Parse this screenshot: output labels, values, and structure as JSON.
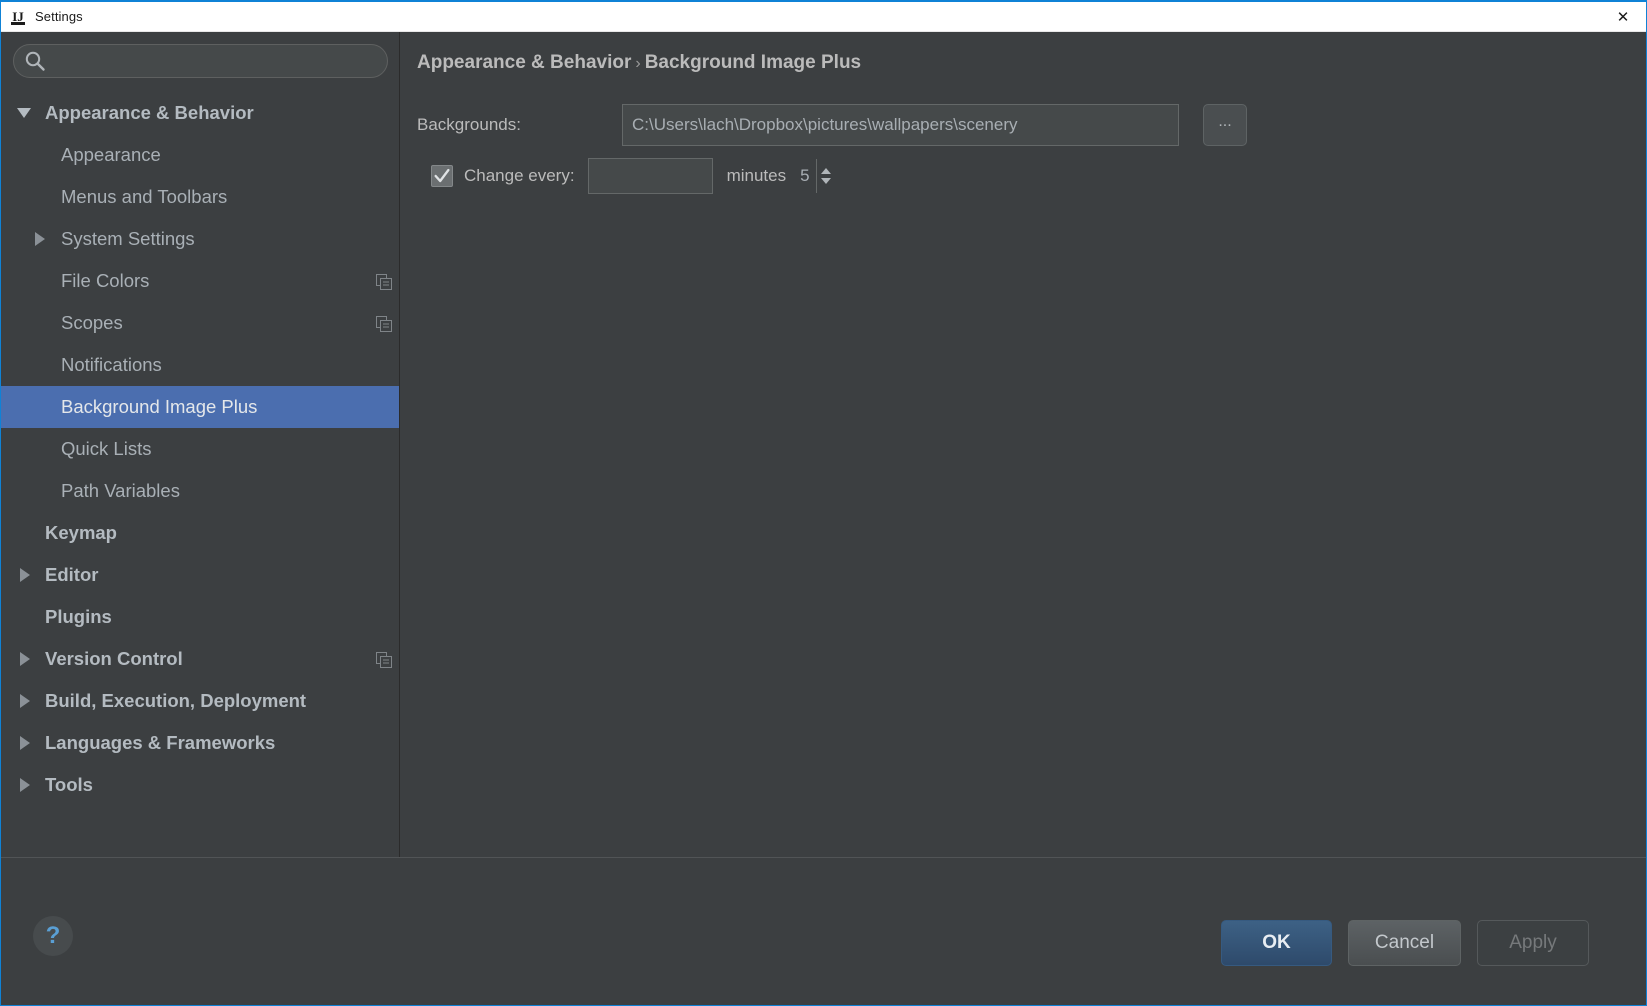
{
  "window": {
    "title": "Settings",
    "icon": "intellij-idea-icon",
    "close_label": "✕"
  },
  "search": {
    "value": "",
    "placeholder": "",
    "icon": "search-icon"
  },
  "sidebar": {
    "items": [
      {
        "label": "Appearance & Behavior",
        "level": 0,
        "arrow": "down",
        "bold": true,
        "selected": false,
        "copy_icon": false
      },
      {
        "label": "Appearance",
        "level": 1,
        "arrow": "none",
        "bold": false,
        "selected": false,
        "copy_icon": false
      },
      {
        "label": "Menus and Toolbars",
        "level": 1,
        "arrow": "none",
        "bold": false,
        "selected": false,
        "copy_icon": false
      },
      {
        "label": "System Settings",
        "level": 1,
        "arrow": "right",
        "bold": false,
        "selected": false,
        "copy_icon": false
      },
      {
        "label": "File Colors",
        "level": 1,
        "arrow": "none",
        "bold": false,
        "selected": false,
        "copy_icon": true
      },
      {
        "label": "Scopes",
        "level": 1,
        "arrow": "none",
        "bold": false,
        "selected": false,
        "copy_icon": true
      },
      {
        "label": "Notifications",
        "level": 1,
        "arrow": "none",
        "bold": false,
        "selected": false,
        "copy_icon": false
      },
      {
        "label": "Background Image Plus",
        "level": 1,
        "arrow": "none",
        "bold": false,
        "selected": true,
        "copy_icon": false
      },
      {
        "label": "Quick Lists",
        "level": 1,
        "arrow": "none",
        "bold": false,
        "selected": false,
        "copy_icon": false
      },
      {
        "label": "Path Variables",
        "level": 1,
        "arrow": "none",
        "bold": false,
        "selected": false,
        "copy_icon": false
      },
      {
        "label": "Keymap",
        "level": 0,
        "arrow": "none",
        "bold": true,
        "selected": false,
        "copy_icon": false
      },
      {
        "label": "Editor",
        "level": 0,
        "arrow": "right",
        "bold": true,
        "selected": false,
        "copy_icon": false
      },
      {
        "label": "Plugins",
        "level": 0,
        "arrow": "none",
        "bold": true,
        "selected": false,
        "copy_icon": false
      },
      {
        "label": "Version Control",
        "level": 0,
        "arrow": "right",
        "bold": true,
        "selected": false,
        "copy_icon": true
      },
      {
        "label": "Build, Execution, Deployment",
        "level": 0,
        "arrow": "right",
        "bold": true,
        "selected": false,
        "copy_icon": false
      },
      {
        "label": "Languages & Frameworks",
        "level": 0,
        "arrow": "right",
        "bold": true,
        "selected": false,
        "copy_icon": false
      },
      {
        "label": "Tools",
        "level": 0,
        "arrow": "right",
        "bold": true,
        "selected": false,
        "copy_icon": false
      }
    ]
  },
  "content": {
    "breadcrumb_parent": "Appearance & Behavior",
    "breadcrumb_separator": "›",
    "breadcrumb_current": "Background Image Plus",
    "backgrounds_label": "Backgrounds:",
    "backgrounds_value": "C:\\Users\\lach\\Dropbox\\pictures\\wallpapers\\scenery",
    "backgrounds_placeholder": "",
    "browse_label": "...",
    "change_every_label": "Change every:",
    "change_every_checked": true,
    "interval_value": "5",
    "interval_unit": "minutes"
  },
  "footer": {
    "help_label": "?",
    "ok_label": "OK",
    "cancel_label": "Cancel",
    "apply_label": "Apply",
    "apply_disabled": true
  },
  "colors": {
    "window_border": "#0f82d6",
    "panel_bg": "#3c3f41",
    "selection_blue": "#4b6eaf",
    "text": "#bbbbbb",
    "help_blue": "#5a9fd4"
  }
}
